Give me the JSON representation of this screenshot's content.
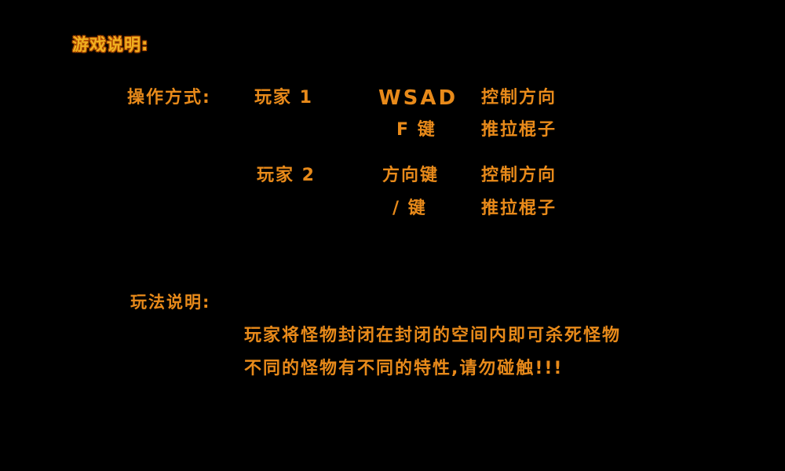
{
  "header": {
    "title": "游戏说明:"
  },
  "controls": {
    "label": "操作方式:",
    "player1": {
      "name": "玩家 1",
      "rows": [
        {
          "key": "WSAD",
          "action": "控制方向"
        },
        {
          "key": "F 键",
          "action": "推拉棍子"
        }
      ]
    },
    "player2": {
      "name": "玩家 2",
      "rows": [
        {
          "key": "方向键",
          "action": "控制方向"
        },
        {
          "key": "/ 键",
          "action": "推拉棍子"
        }
      ]
    }
  },
  "rules": {
    "label": "玩法说明:",
    "lines": [
      "玩家将怪物封闭在封闭的空间内即可杀死怪物",
      "不同的怪物有不同的特性,请勿碰触!!!"
    ]
  },
  "colors": {
    "background": "#000000",
    "text": "#e88a1a",
    "title": "#f0b020"
  }
}
